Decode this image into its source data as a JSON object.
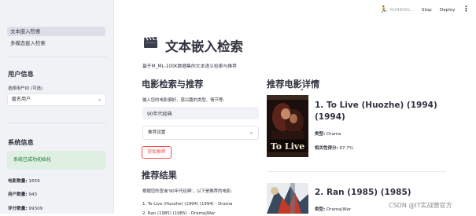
{
  "header": {
    "running_text": "RUNNING...",
    "stop_label": "Stop",
    "deploy_label": "Deploy",
    "menu_icon": "⋮"
  },
  "sidebar": {
    "nav": [
      {
        "label": "文本嵌入检索",
        "active": true
      },
      {
        "label": "多模态嵌入检索",
        "active": false
      }
    ],
    "user_section_title": "用户信息",
    "user_select_label": "选择用户ID (可选)",
    "user_select_value": "匿名用户",
    "system_section_title": "系统信息",
    "system_status": "系统已成功初始化",
    "stats": [
      {
        "label": "电影数量:",
        "value": "1659"
      },
      {
        "label": "用户数量:",
        "value": "943"
      },
      {
        "label": "评分数量:",
        "value": "99309"
      }
    ]
  },
  "main": {
    "title": "文本嵌入检索",
    "title_icon": "clapper-board-icon",
    "subtitle": "基于M_ML-100K数据集的文本语义检索与推荐",
    "search_header": "电影检索与推荐",
    "input_label": "输入您的电影偏好、感兴趣的类型、情节等:",
    "input_value": "90年代经典",
    "expander_label": "推荐设置",
    "get_button": "获取推荐",
    "results_header": "推荐结果",
    "results_intro": "根据您的查询'90年代经典'，以下是推荐的电影:",
    "results_list": [
      "1.   To Live (Huozhe) (1994) (1994) - Drama",
      "2.   Ran (1985) (1985) - Drama|War"
    ],
    "details_header": "推荐电影详情",
    "movies": [
      {
        "title": "1. To Live (Huozhe) (1994) (1994)",
        "poster_text": "To Live",
        "genre_label": "类型:",
        "genre": "Drama",
        "score_label": "相关性得分:",
        "score": "67.7%"
      },
      {
        "title": "2. Ran (1985) (1985)",
        "genre_label": "类型:",
        "genre": "Drama|War"
      }
    ]
  },
  "watermark": "CSDN @IT实战营官方",
  "colors": {
    "accent": "#ff4b4b",
    "sidebar_bg": "#f0f2f6",
    "success_bg": "#dff0e3",
    "success_text": "#177233"
  }
}
